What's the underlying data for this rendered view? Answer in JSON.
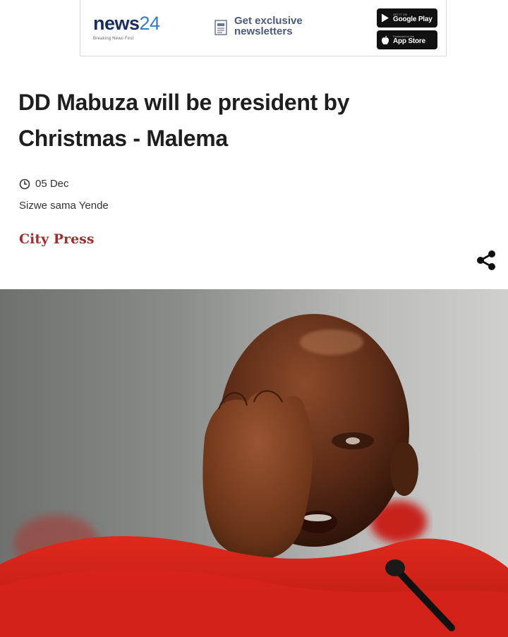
{
  "banner": {
    "brand_main": "news",
    "brand_num": "24",
    "brand_tagline": "Breaking News First",
    "newsletter_label": "Get exclusive newsletters",
    "google_play": {
      "small": "GET IT ON",
      "big": "Google Play"
    },
    "app_store": {
      "small": "Download on the",
      "big": "App Store"
    }
  },
  "article": {
    "headline": "DD Mabuza will be president by Christmas - Malema",
    "date": "05 Dec",
    "author": "Sizwe sama Yende",
    "publisher": "City Press"
  },
  "icons": {
    "clock": "clock-icon",
    "share": "share-icon",
    "newsletter": "newsletter-icon"
  },
  "colors": {
    "brand_dark": "#1a2d5c",
    "brand_light": "#2f7fd1",
    "publisher": "#9a3030",
    "photo_red": "#d3261c"
  }
}
